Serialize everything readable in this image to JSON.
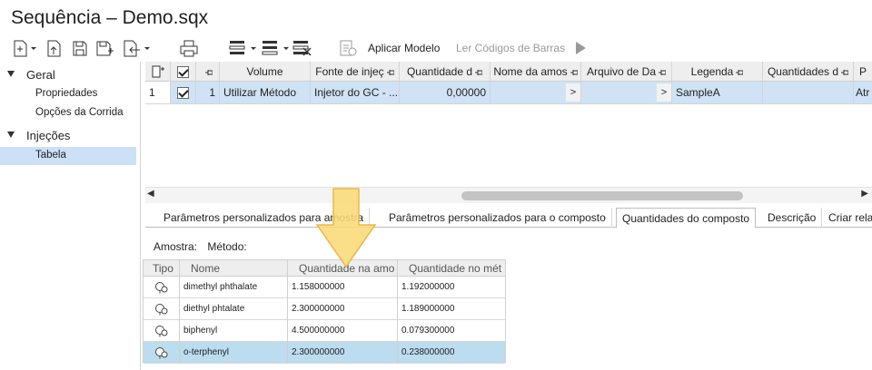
{
  "window": {
    "title": "Sequência – Demo.sqx"
  },
  "toolbar": {
    "apply_model": "Aplicar Modelo",
    "read_barcodes": "Ler Códigos de Barras"
  },
  "sidebar": {
    "groups": [
      {
        "label": "Geral",
        "items": [
          "Propriedades",
          "Opções da Corrida"
        ]
      },
      {
        "label": "Injeções",
        "items": [
          "Tabela"
        ]
      }
    ]
  },
  "grid": {
    "headers": [
      "Volume",
      "Fonte de injeç",
      "Quantidade d",
      "Nome da amos",
      "Arquivo de Da",
      "Legenda",
      "Quantidades d",
      "P"
    ],
    "row": {
      "number": "1",
      "index": "1",
      "method": "Utilizar Método",
      "source": "Injetor do GC - ...",
      "quantity": "0,00000",
      "sample_name_btn": ">",
      "data_file_btn": ">",
      "legend": "SampleA",
      "last": "Atr"
    }
  },
  "tabs": [
    "Parâmetros personalizados para amostra",
    "Parâmetros personalizados para o composto",
    "Quantidades do composto",
    "Descrição",
    "Criar rela"
  ],
  "active_tab": "Quantidades do composto",
  "info": {
    "sample_label": "Amostra:",
    "method_label": "Método:"
  },
  "compounds": {
    "headers": [
      "Tipo",
      "Nome",
      "Quantidade na amo",
      "Quantidade no mét"
    ],
    "rows": [
      {
        "name": "dimethyl phthalate",
        "sample_qty": "1.158000000",
        "method_qty": "1.192000000"
      },
      {
        "name": "diethyl phtalate",
        "sample_qty": "2.300000000",
        "method_qty": "1.189000000"
      },
      {
        "name": "biphenyl",
        "sample_qty": "4.500000000",
        "method_qty": "0.079300000"
      },
      {
        "name": "o-terphenyl",
        "sample_qty": "2.300000000",
        "method_qty": "0.238000000"
      }
    ]
  },
  "colors": {
    "selection": "#cce0f7",
    "arrow": "#fbd977",
    "arrow_border": "#e8b94a"
  }
}
